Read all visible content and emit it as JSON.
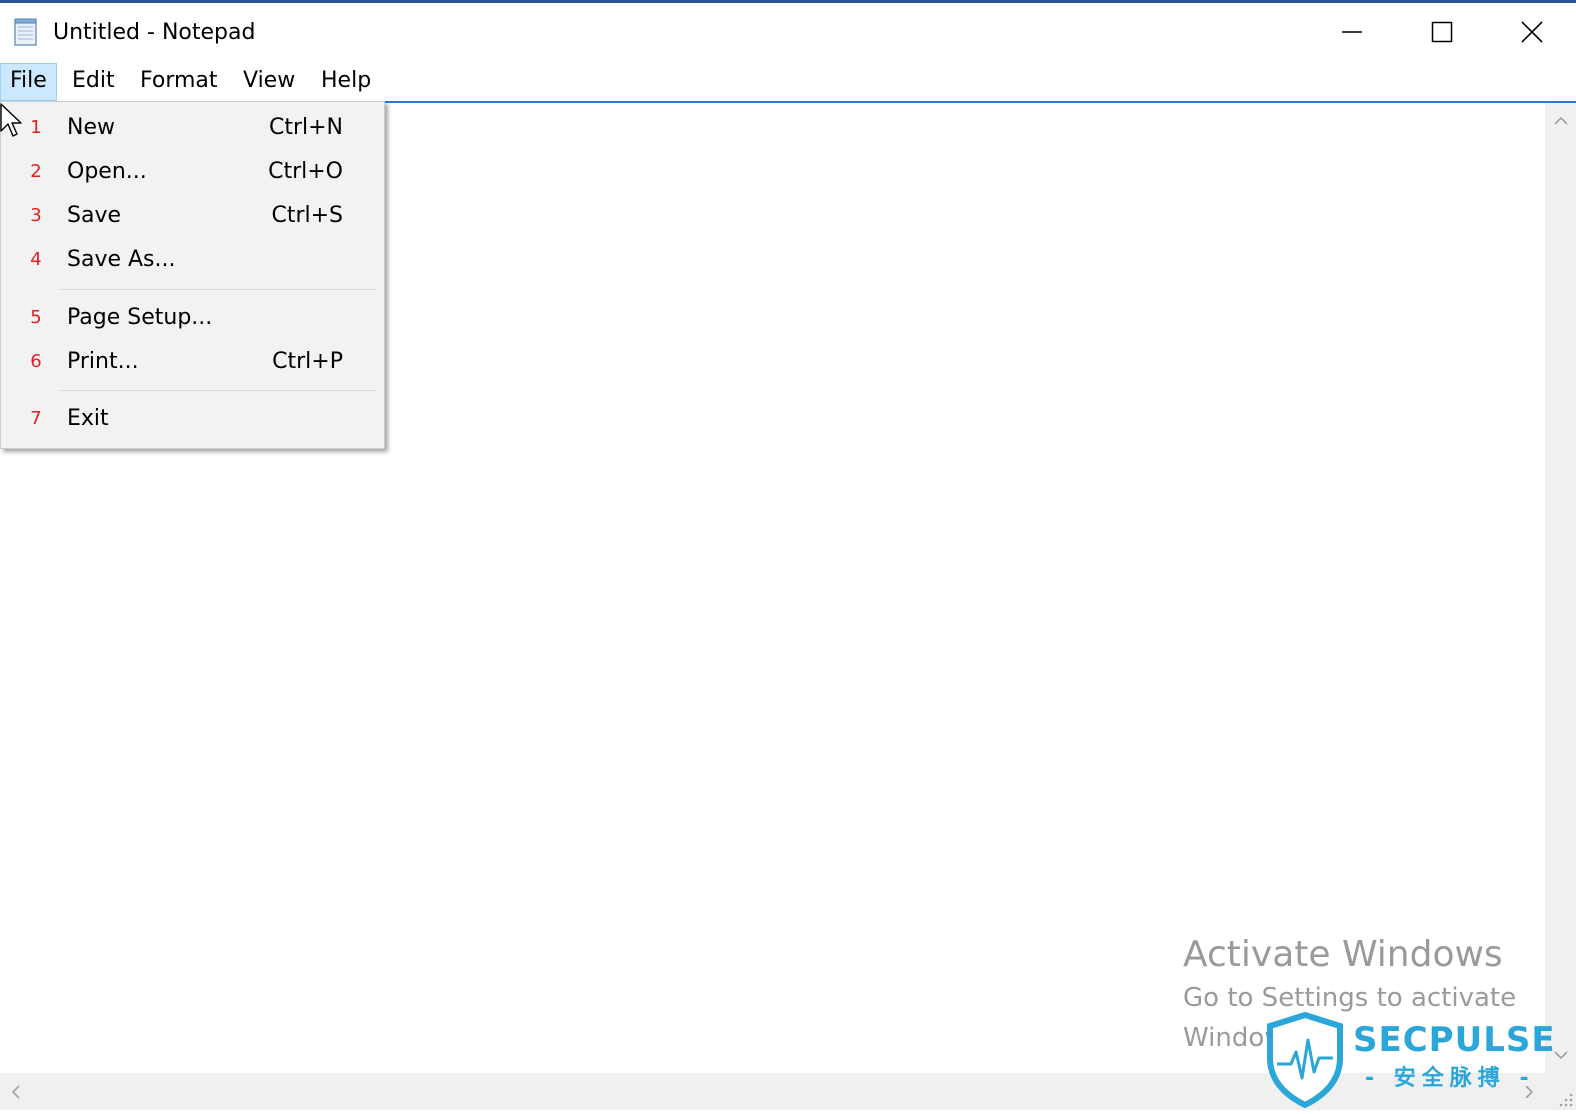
{
  "window": {
    "title": "Untitled - Notepad",
    "controls": {
      "minimize": "minimize-icon",
      "maximize": "maximize-icon",
      "close": "close-icon"
    }
  },
  "menubar": {
    "items": [
      {
        "label": "File",
        "active": true
      },
      {
        "label": "Edit",
        "active": false
      },
      {
        "label": "Format",
        "active": false
      },
      {
        "label": "View",
        "active": false
      },
      {
        "label": "Help",
        "active": false
      }
    ]
  },
  "file_menu": {
    "items": [
      {
        "number": "1",
        "label": "New",
        "shortcut": "Ctrl+N"
      },
      {
        "number": "2",
        "label": "Open...",
        "shortcut": "Ctrl+O"
      },
      {
        "number": "3",
        "label": "Save",
        "shortcut": "Ctrl+S"
      },
      {
        "number": "4",
        "label": "Save As...",
        "shortcut": ""
      },
      {
        "number": "5",
        "label": "Page Setup...",
        "shortcut": ""
      },
      {
        "number": "6",
        "label": "Print...",
        "shortcut": "Ctrl+P"
      },
      {
        "number": "7",
        "label": "Exit",
        "shortcut": ""
      }
    ]
  },
  "editor": {
    "content": ""
  },
  "watermark": {
    "activate_title": "Activate Windows",
    "activate_line1": "Go to Settings to activate",
    "activate_line2": "Windows.",
    "logo_text": "SECPULSE",
    "logo_subtext": "- 安全脉搏 -"
  },
  "colors": {
    "accent": "#2b7bd4",
    "menu_active_bg": "#cce8ff",
    "menu_number": "#e02020",
    "watermark_text": "#9a9a9a",
    "logo": "#2aa6d8"
  }
}
